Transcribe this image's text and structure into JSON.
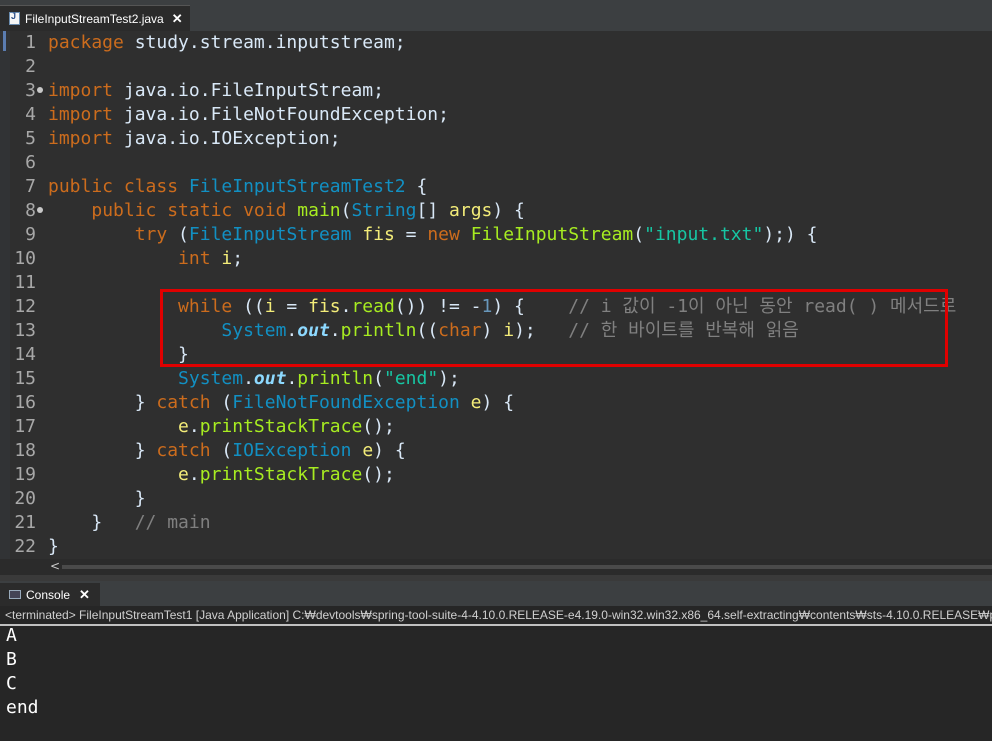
{
  "editor": {
    "tab_title": "FileInputStreamTest2.java",
    "tab_close": "✕",
    "lines": [
      {
        "n": "1",
        "tokens": [
          [
            "kw",
            "package"
          ],
          [
            "pl",
            " study.stream.inputstream;"
          ]
        ]
      },
      {
        "n": "2",
        "tokens": []
      },
      {
        "n": "3",
        "fold": true,
        "tokens": [
          [
            "kw",
            "import"
          ],
          [
            "pl",
            " java.io.FileInputStream;"
          ]
        ]
      },
      {
        "n": "4",
        "tokens": [
          [
            "kw",
            "import"
          ],
          [
            "pl",
            " java.io.FileNotFoundException;"
          ]
        ]
      },
      {
        "n": "5",
        "tokens": [
          [
            "kw",
            "import"
          ],
          [
            "pl",
            " java.io.IOException;"
          ]
        ]
      },
      {
        "n": "6",
        "tokens": []
      },
      {
        "n": "7",
        "tokens": [
          [
            "kw",
            "public class "
          ],
          [
            "ty",
            "FileInputStreamTest2"
          ],
          [
            "pl",
            " {"
          ]
        ]
      },
      {
        "n": "8",
        "fold": true,
        "tokens": [
          [
            "pl",
            "    "
          ],
          [
            "kw",
            "public static void "
          ],
          [
            "fn",
            "main"
          ],
          [
            "pl",
            "("
          ],
          [
            "ty",
            "String"
          ],
          [
            "pl",
            "[] "
          ],
          [
            "var",
            "args"
          ],
          [
            "pl",
            ") {"
          ]
        ]
      },
      {
        "n": "9",
        "tokens": [
          [
            "pl",
            "        "
          ],
          [
            "kw",
            "try"
          ],
          [
            "pl",
            " ("
          ],
          [
            "ty",
            "FileInputStream"
          ],
          [
            "pl",
            " "
          ],
          [
            "var",
            "fis"
          ],
          [
            "pl",
            " = "
          ],
          [
            "kw",
            "new"
          ],
          [
            "pl",
            " "
          ],
          [
            "fn",
            "FileInputStream"
          ],
          [
            "pl",
            "("
          ],
          [
            "str",
            "\"input.txt\""
          ],
          [
            "pl",
            ");) {"
          ]
        ]
      },
      {
        "n": "10",
        "tokens": [
          [
            "pl",
            "            "
          ],
          [
            "kw",
            "int"
          ],
          [
            "pl",
            " "
          ],
          [
            "var",
            "i"
          ],
          [
            "pl",
            ";"
          ]
        ]
      },
      {
        "n": "11",
        "tokens": []
      },
      {
        "n": "12",
        "tokens": [
          [
            "pl",
            "            "
          ],
          [
            "kw",
            "while"
          ],
          [
            "pl",
            " (("
          ],
          [
            "var",
            "i"
          ],
          [
            "pl",
            " = "
          ],
          [
            "var",
            "fis"
          ],
          [
            "pl",
            "."
          ],
          [
            "fn",
            "read"
          ],
          [
            "pl",
            "()) != -"
          ],
          [
            "num",
            "1"
          ],
          [
            "pl",
            ") {    "
          ],
          [
            "cm",
            "// i 값이 -1이 아닌 동안 read( ) 메서드로"
          ]
        ]
      },
      {
        "n": "13",
        "tokens": [
          [
            "pl",
            "                "
          ],
          [
            "ty",
            "System"
          ],
          [
            "pl",
            "."
          ],
          [
            "sf",
            "out"
          ],
          [
            "pl",
            "."
          ],
          [
            "fn",
            "println"
          ],
          [
            "pl",
            "(("
          ],
          [
            "kw",
            "char"
          ],
          [
            "pl",
            ") "
          ],
          [
            "var",
            "i"
          ],
          [
            "pl",
            ");   "
          ],
          [
            "cm",
            "// 한 바이트를 반복해 읽음"
          ]
        ]
      },
      {
        "n": "14",
        "tokens": [
          [
            "pl",
            "            }"
          ]
        ]
      },
      {
        "n": "15",
        "tokens": [
          [
            "pl",
            "            "
          ],
          [
            "ty",
            "System"
          ],
          [
            "pl",
            "."
          ],
          [
            "sf",
            "out"
          ],
          [
            "pl",
            "."
          ],
          [
            "fn",
            "println"
          ],
          [
            "pl",
            "("
          ],
          [
            "str",
            "\"end\""
          ],
          [
            "pl",
            ");"
          ]
        ]
      },
      {
        "n": "16",
        "tokens": [
          [
            "pl",
            "        } "
          ],
          [
            "kw",
            "catch"
          ],
          [
            "pl",
            " ("
          ],
          [
            "ty",
            "FileNotFoundException"
          ],
          [
            "pl",
            " "
          ],
          [
            "var",
            "e"
          ],
          [
            "pl",
            ") {"
          ]
        ]
      },
      {
        "n": "17",
        "tokens": [
          [
            "pl",
            "            "
          ],
          [
            "var",
            "e"
          ],
          [
            "pl",
            "."
          ],
          [
            "fn",
            "printStackTrace"
          ],
          [
            "pl",
            "();"
          ]
        ]
      },
      {
        "n": "18",
        "tokens": [
          [
            "pl",
            "        } "
          ],
          [
            "kw",
            "catch"
          ],
          [
            "pl",
            " ("
          ],
          [
            "ty",
            "IOException"
          ],
          [
            "pl",
            " "
          ],
          [
            "var",
            "e"
          ],
          [
            "pl",
            ") {"
          ]
        ]
      },
      {
        "n": "19",
        "tokens": [
          [
            "pl",
            "            "
          ],
          [
            "var",
            "e"
          ],
          [
            "pl",
            "."
          ],
          [
            "fn",
            "printStackTrace"
          ],
          [
            "pl",
            "();"
          ]
        ]
      },
      {
        "n": "20",
        "tokens": [
          [
            "pl",
            "        }"
          ]
        ]
      },
      {
        "n": "21",
        "tokens": [
          [
            "pl",
            "    }   "
          ],
          [
            "cm",
            "// main"
          ]
        ]
      },
      {
        "n": "22",
        "tokens": [
          [
            "pl",
            "}"
          ]
        ]
      }
    ],
    "scroll_arrow": "<"
  },
  "console": {
    "tab_title": "Console",
    "tab_close": "✕",
    "terminated_line": "<terminated> FileInputStreamTest1 [Java Application] C:₩devtools₩spring-tool-suite-4-4.10.0.RELEASE-e4.19.0-win32.win32.x86_64.self-extracting₩contents₩sts-4.10.0.RELEASE₩plu",
    "output": [
      "A",
      "B",
      "C",
      "end"
    ]
  },
  "colors": {
    "keyword": "#cc6c1d",
    "type": "#1290c3",
    "string": "#17c6a3",
    "comment": "#808080",
    "method": "#a7ec21",
    "highlight_border": "#e00000"
  }
}
